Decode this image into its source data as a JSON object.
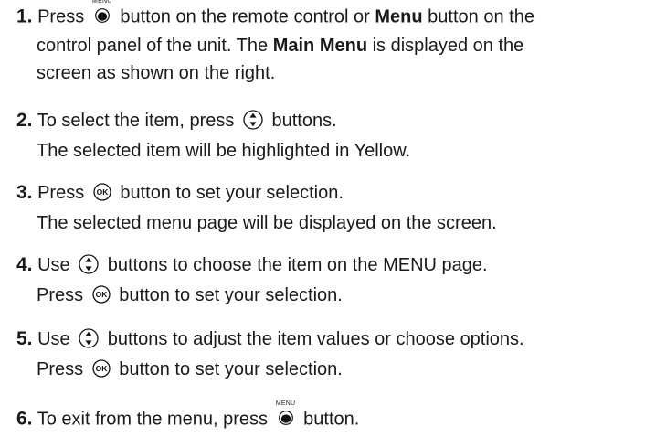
{
  "icons": {
    "menu": "menu-button-icon",
    "updown": "up-down-arrow-button-icon",
    "ok": "ok-button-icon",
    "menu_label": "MENU",
    "ok_label": "OK"
  },
  "steps": [
    {
      "number": "1.",
      "t1": "Press",
      "t2": "button on the remote control or",
      "bold1": "Menu",
      "t3": "button on the",
      "line2a": "control panel of the unit. The",
      "bold2": "Main Menu",
      "line2b": "is displayed on the",
      "line3": "screen as shown on the right."
    },
    {
      "number": "2.",
      "t1": "To select the item, press",
      "t2": "buttons.",
      "line2": "The selected item will be highlighted in Yellow."
    },
    {
      "number": "3.",
      "t1": "Press",
      "t2": "button to set your selection.",
      "line2": "The selected menu page will be displayed on the screen."
    },
    {
      "number": "4.",
      "t1": "Use",
      "t2": "buttons to choose the item on the MENU page.",
      "line2a": "Press",
      "line2b": "button to set your selection."
    },
    {
      "number": "5.",
      "t1": "Use",
      "t2": "buttons to adjust the item values or choose options.",
      "line2a": "Press",
      "line2b": "button to set your selection."
    },
    {
      "number": "6.",
      "t1": "To exit from the menu, press",
      "t2": "button."
    }
  ]
}
